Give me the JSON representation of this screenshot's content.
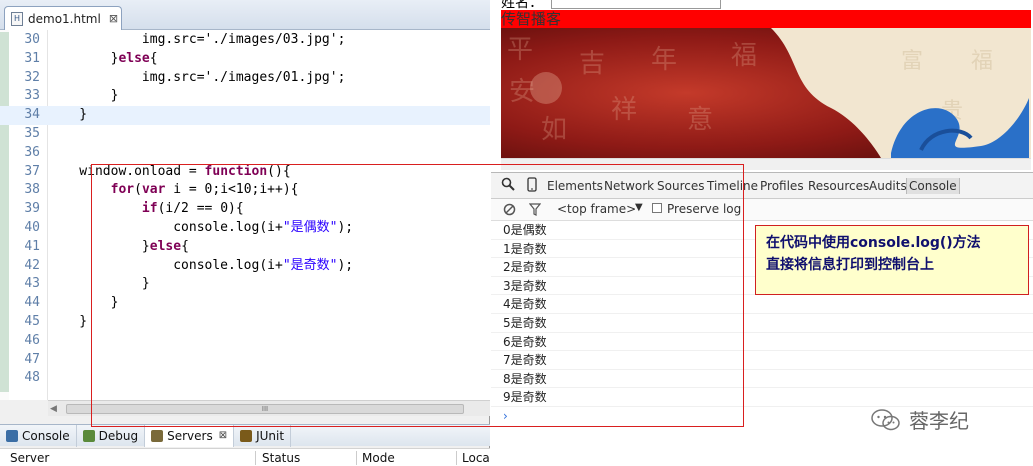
{
  "editor": {
    "tab_label": "demo1.html",
    "file_icon_letter": "H",
    "close_glyph": "⊠",
    "lines": [
      {
        "num": "30",
        "parts": [
          {
            "t": "            img.src='./images/03.jpg';",
            "c": ""
          }
        ]
      },
      {
        "num": "31",
        "parts": [
          {
            "t": "        }",
            "c": ""
          },
          {
            "t": "else",
            "c": "kw"
          },
          {
            "t": "{",
            "c": ""
          }
        ]
      },
      {
        "num": "32",
        "parts": [
          {
            "t": "            img.src='./images/01.jpg';",
            "c": ""
          }
        ]
      },
      {
        "num": "33",
        "parts": [
          {
            "t": "        }",
            "c": ""
          }
        ]
      },
      {
        "num": "34",
        "parts": [
          {
            "t": "    }",
            "c": ""
          }
        ]
      },
      {
        "num": "35",
        "parts": [
          {
            "t": "",
            "c": ""
          }
        ]
      },
      {
        "num": "36",
        "parts": [
          {
            "t": "",
            "c": ""
          }
        ]
      },
      {
        "num": "37",
        "parts": [
          {
            "t": "    window.onload = ",
            "c": ""
          },
          {
            "t": "function",
            "c": "kw"
          },
          {
            "t": "(){",
            "c": ""
          }
        ]
      },
      {
        "num": "38",
        "parts": [
          {
            "t": "        ",
            "c": ""
          },
          {
            "t": "for",
            "c": "kw"
          },
          {
            "t": "(",
            "c": ""
          },
          {
            "t": "var",
            "c": "kw"
          },
          {
            "t": " i = 0;i<10;i++){",
            "c": ""
          }
        ]
      },
      {
        "num": "39",
        "parts": [
          {
            "t": "            ",
            "c": ""
          },
          {
            "t": "if",
            "c": "kw"
          },
          {
            "t": "(i/2 == 0){",
            "c": ""
          }
        ]
      },
      {
        "num": "40",
        "parts": [
          {
            "t": "                console.log(i+",
            "c": ""
          },
          {
            "t": "\"是偶数\"",
            "c": "str"
          },
          {
            "t": ");",
            "c": ""
          }
        ]
      },
      {
        "num": "41",
        "parts": [
          {
            "t": "            }",
            "c": ""
          },
          {
            "t": "else",
            "c": "kw"
          },
          {
            "t": "{",
            "c": ""
          }
        ]
      },
      {
        "num": "42",
        "parts": [
          {
            "t": "                console.log(i+",
            "c": ""
          },
          {
            "t": "\"是奇数\"",
            "c": "str"
          },
          {
            "t": ");",
            "c": ""
          }
        ]
      },
      {
        "num": "43",
        "parts": [
          {
            "t": "            }",
            "c": ""
          }
        ]
      },
      {
        "num": "44",
        "parts": [
          {
            "t": "        }",
            "c": ""
          }
        ]
      },
      {
        "num": "45",
        "parts": [
          {
            "t": "    }",
            "c": ""
          }
        ]
      },
      {
        "num": "46",
        "parts": [
          {
            "t": "",
            "c": ""
          }
        ]
      },
      {
        "num": "47",
        "parts": [
          {
            "t": "",
            "c": ""
          }
        ]
      },
      {
        "num": "48",
        "parts": [
          {
            "t": "",
            "c": ""
          }
        ]
      }
    ],
    "scroll_thumb_glyph": "III"
  },
  "views": {
    "tabs": [
      {
        "label": "Console",
        "icon_color": "#3b6ea5",
        "active": false
      },
      {
        "label": "Debug",
        "icon_color": "#5a8a3a",
        "active": false
      },
      {
        "label": "Servers",
        "icon_color": "#7a6a3a",
        "active": true
      },
      {
        "label": "JUnit",
        "icon_color": "#7a5a1a",
        "active": false
      }
    ],
    "close_glyph": "⊠",
    "columns": [
      "Server",
      "Status",
      "Mode",
      "Loca"
    ]
  },
  "browser": {
    "page_label": "姓名：",
    "red_bar_text": "传智播客",
    "devtools_tabs": [
      "Elements",
      "Network",
      "Sources",
      "Timeline",
      "Profiles",
      "Resources",
      "Audits",
      "Console"
    ],
    "selected_tab": "Console",
    "frame_select": "<top frame>",
    "preserve_log_label": "Preserve log",
    "console_lines": [
      "0是偶数",
      "1是奇数",
      "2是奇数",
      "3是奇数",
      "4是奇数",
      "5是奇数",
      "6是奇数",
      "7是奇数",
      "8是奇数",
      "9是奇数"
    ],
    "prompt_glyph": "›"
  },
  "callout": {
    "line1": "在代码中使用console.log()方法",
    "line2": "直接将信息打印到控制台上"
  },
  "watermark": {
    "text": "蓉李纪"
  },
  "colors": {
    "annotation_red": "#d91f1f",
    "keyword": "#7f0055",
    "string": "#2a00ff",
    "line_number": "#5f7fa8"
  }
}
